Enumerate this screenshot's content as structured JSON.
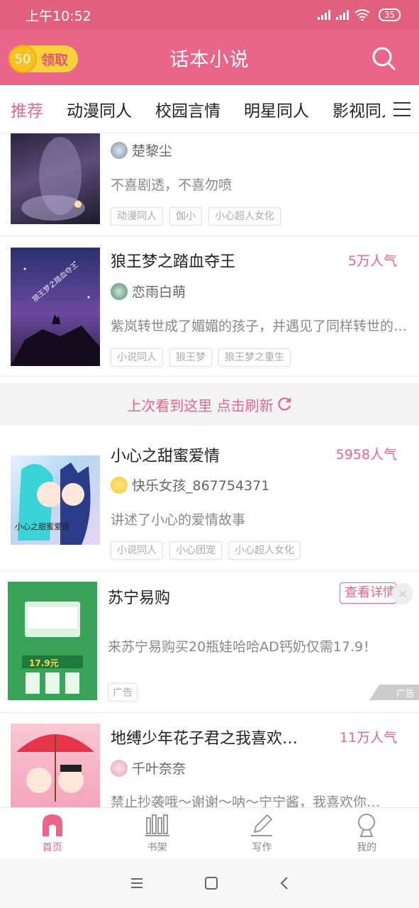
{
  "status": {
    "time": "上午10:52",
    "battery": "35"
  },
  "header": {
    "coin_value": "50",
    "coin_label": "领取",
    "title": "话本小说"
  },
  "tabs": [
    {
      "label": "推荐"
    },
    {
      "label": "动漫同人"
    },
    {
      "label": "校园言情"
    },
    {
      "label": "明星同人"
    },
    {
      "label": "影视同人"
    }
  ],
  "feed": {
    "items": [
      {
        "title": "",
        "popularity": "",
        "author": "楚黎尘",
        "description": "不喜剧透，不喜勿喷",
        "tags": [
          "动漫同人",
          "伽小",
          "小心超人女化"
        ]
      },
      {
        "title": "狼王梦之踏血夺王",
        "popularity": "5万人气",
        "author": "恋雨白萌",
        "description": "紫岚转世成了媚媚的孩子，并遇见了同样转世的…",
        "tags": [
          "小说同人",
          "狼王梦",
          "狼王梦之重生"
        ],
        "cover_text": "狼王梦之踏血夺王"
      },
      {
        "title": "小心之甜蜜爱情",
        "popularity": "5958人气",
        "author": "快乐女孩_867754371",
        "description": "讲述了小心的爱情故事",
        "tags": [
          "小说同人",
          "小心团宠",
          "小心超人女化"
        ],
        "cover_text": "小心之甜蜜爱情"
      },
      {
        "title": "地缚少年花子君之我喜欢你宁宁酱",
        "popularity": "11万人气",
        "author": "千叶奈奈",
        "description": "禁止抄袭哦～谢谢～呐～宁宁酱，我喜欢你…",
        "tags": []
      }
    ],
    "refresh_text": "上次看到这里 点击刷新"
  },
  "ad": {
    "title": "苏宁易购",
    "button": "查看详情",
    "description": "来苏宁易购买20瓶娃哈哈AD钙奶仅需17.9！",
    "badge": "广告",
    "mark": "广告",
    "price": "17.9元"
  },
  "bottom_nav": [
    {
      "label": "首页"
    },
    {
      "label": "书架"
    },
    {
      "label": "写作"
    },
    {
      "label": "我的"
    }
  ],
  "colors": {
    "brand": "#e9658a",
    "status_bar": "#e0607e"
  }
}
